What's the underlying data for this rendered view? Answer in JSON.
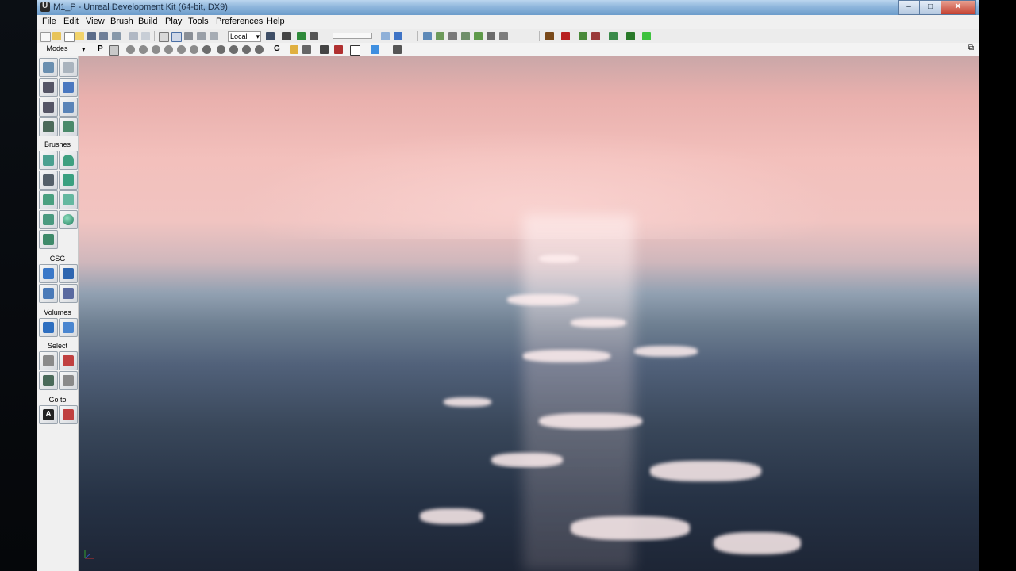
{
  "window": {
    "title": "M1_P - Unreal Development Kit (64-bit, DX9)",
    "controls": {
      "minimize": "–",
      "maximize": "□",
      "close": "✕"
    }
  },
  "menu": [
    "File",
    "Edit",
    "View",
    "Brush",
    "Build",
    "Play",
    "Tools",
    "Preferences",
    "Help"
  ],
  "toolbar": {
    "coordinate_system": "Local",
    "icons": [
      "new-icon",
      "open-icon",
      "save-icon",
      "save-all-icon",
      "undo-icon",
      "redo-icon",
      "select-icon",
      "translate-icon",
      "rotate-icon",
      "scale-icon",
      "nonuniform-scale-icon",
      "find-icon",
      "content-browser-icon",
      "scene-icon",
      "kismet-icon",
      "build-geometry-icon",
      "build-lighting-icon",
      "build-paths-icon",
      "build-all-icon",
      "play-in-editor-icon"
    ]
  },
  "viewport_toolbar": {
    "modes_label": "Modes",
    "perspective_label": "P",
    "game_label": "G"
  },
  "modes_panel": {
    "sections": {
      "brushes": "Brushes",
      "csg": "CSG",
      "volumes": "Volumes",
      "select": "Select",
      "goto": "Go to"
    },
    "goto_button_label": "A"
  },
  "colors": {
    "title_gradient_top": "#bcd6ee",
    "title_gradient_bottom": "#6c9ccb",
    "panel_bg": "#f0f0f0",
    "sky": "#f1c4c1",
    "water": "#263245"
  }
}
